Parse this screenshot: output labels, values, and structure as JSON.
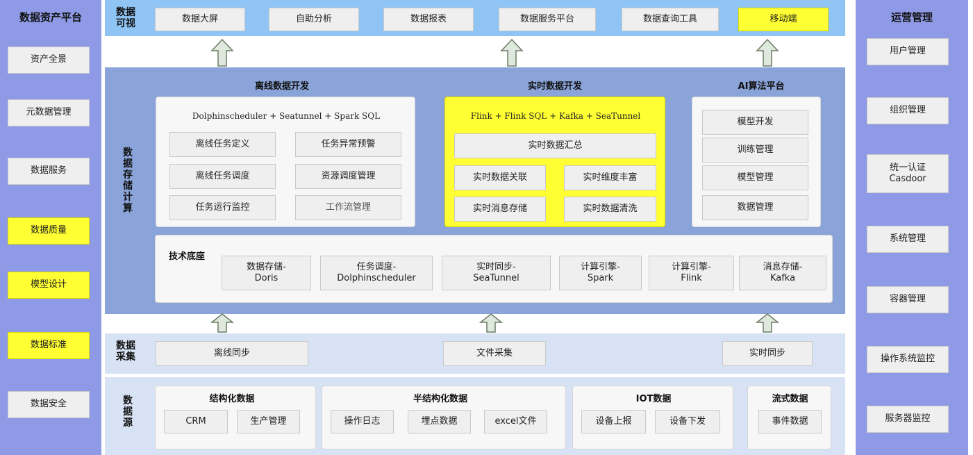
{
  "left_panel": {
    "title": "数据资产平台",
    "items": [
      "资产全景",
      "元数据管理",
      "数据服务",
      "数据质量",
      "模型设计",
      "数据标准",
      "数据安全"
    ]
  },
  "right_panel": {
    "title": "运营管理",
    "items": [
      "用户管理",
      "组织管理",
      "统一认证\nCasdoor",
      "系统管理",
      "容器管理",
      "操作系统监控",
      "服务器监控"
    ]
  },
  "viz": {
    "label": "数据\n可视",
    "items": [
      "数据大屏",
      "自助分析",
      "数据报表",
      "数据服务平台",
      "数据查询工具",
      "移动端"
    ]
  },
  "storage": {
    "label": "数\n据\n存\n储\n计\n算",
    "offline": {
      "title": "离线数据开发",
      "stack": "Dolphinscheduler  +   Seatunnel  +  Spark SQL",
      "items": [
        "离线任务定义",
        "任务异常预警",
        "离线任务调度",
        "资源调度管理",
        "任务运行监控",
        "工作流管理"
      ]
    },
    "realtime": {
      "title": "实时数据开发",
      "stack": "Flink + Flink SQL + Kafka + SeaTunnel",
      "summary": "实时数据汇总",
      "items": [
        "实时数据关联",
        "实时维度丰富",
        "实时消息存储",
        "实时数据清洗"
      ]
    },
    "ai": {
      "title": "AI算法平台",
      "items": [
        "模型开发",
        "训练管理",
        "模型管理",
        "数据管理"
      ]
    },
    "base": {
      "title": "技术底座",
      "items": [
        "数据存储-\nDoris",
        "任务调度-\nDolphinscheduler",
        "实时同步-\nSeaTunnel",
        "计算引擎-\nSpark",
        "计算引擎-\nFlink",
        "消息存储-\nKafka"
      ]
    }
  },
  "collect": {
    "label": "数据\n采集",
    "items": [
      "离线同步",
      "文件采集",
      "实时同步"
    ]
  },
  "source": {
    "label": "数\n据\n源",
    "groups": [
      {
        "title": "结构化数据",
        "items": [
          "CRM",
          "生产管理"
        ]
      },
      {
        "title": "半结构化数据",
        "items": [
          "操作日志",
          "埋点数据",
          "excel文件"
        ]
      },
      {
        "title": "IOT数据",
        "items": [
          "设备上报",
          "设备下发"
        ]
      },
      {
        "title": "流式数据",
        "items": [
          "事件数据"
        ]
      }
    ]
  },
  "colors": {
    "side_panel": "#8f9ae6",
    "viz_band": "#8fc4f5",
    "storage_band": "#8aa3d8",
    "collect_band": "#d7e3f4",
    "source_band": "#d7e3f4",
    "highlight": "#ffff33"
  }
}
